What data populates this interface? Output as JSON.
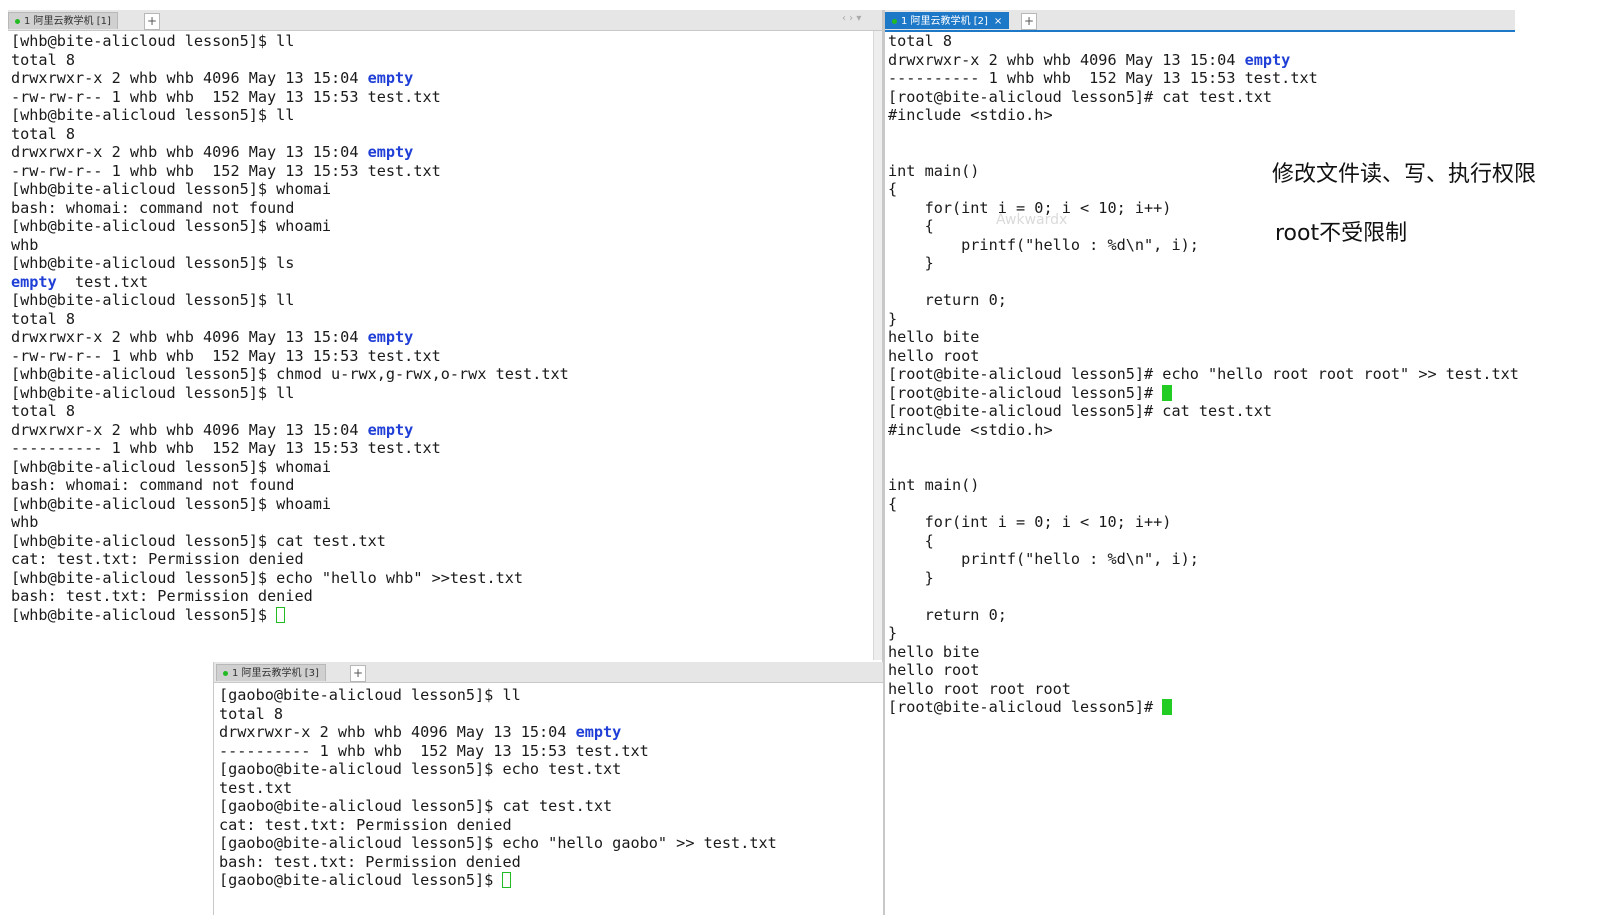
{
  "panes": {
    "left": {
      "tab_label": "1 阿里云教学机 [1]",
      "lines": [
        [
          {
            "t": "[whb@bite-alicloud lesson5]$ ll"
          }
        ],
        [
          {
            "t": "total 8"
          }
        ],
        [
          {
            "t": "drwxrwxr-x 2 whb whb 4096 May 13 15:04 "
          },
          {
            "t": "empty",
            "c": "blue"
          }
        ],
        [
          {
            "t": "-rw-rw-r-- 1 whb whb  152 May 13 15:53 test.txt"
          }
        ],
        [
          {
            "t": "[whb@bite-alicloud lesson5]$ ll"
          }
        ],
        [
          {
            "t": "total 8"
          }
        ],
        [
          {
            "t": "drwxrwxr-x 2 whb whb 4096 May 13 15:04 "
          },
          {
            "t": "empty",
            "c": "blue"
          }
        ],
        [
          {
            "t": "-rw-rw-r-- 1 whb whb  152 May 13 15:53 test.txt"
          }
        ],
        [
          {
            "t": "[whb@bite-alicloud lesson5]$ whomai"
          }
        ],
        [
          {
            "t": "bash: whomai: command not found"
          }
        ],
        [
          {
            "t": "[whb@bite-alicloud lesson5]$ whoami"
          }
        ],
        [
          {
            "t": "whb"
          }
        ],
        [
          {
            "t": "[whb@bite-alicloud lesson5]$ ls"
          }
        ],
        [
          {
            "t": "empty",
            "c": "blue"
          },
          {
            "t": "  test.txt"
          }
        ],
        [
          {
            "t": "[whb@bite-alicloud lesson5]$ ll"
          }
        ],
        [
          {
            "t": "total 8"
          }
        ],
        [
          {
            "t": "drwxrwxr-x 2 whb whb 4096 May 13 15:04 "
          },
          {
            "t": "empty",
            "c": "blue"
          }
        ],
        [
          {
            "t": "-rw-rw-r-- 1 whb whb  152 May 13 15:53 test.txt"
          }
        ],
        [
          {
            "t": "[whb@bite-alicloud lesson5]$ chmod u-rwx,g-rwx,o-rwx test.txt"
          }
        ],
        [
          {
            "t": "[whb@bite-alicloud lesson5]$ ll"
          }
        ],
        [
          {
            "t": "total 8"
          }
        ],
        [
          {
            "t": "drwxrwxr-x 2 whb whb 4096 May 13 15:04 "
          },
          {
            "t": "empty",
            "c": "blue"
          }
        ],
        [
          {
            "t": "---------- 1 whb whb  152 May 13 15:53 test.txt"
          }
        ],
        [
          {
            "t": "[whb@bite-alicloud lesson5]$ whomai"
          }
        ],
        [
          {
            "t": "bash: whomai: command not found"
          }
        ],
        [
          {
            "t": "[whb@bite-alicloud lesson5]$ whoami"
          }
        ],
        [
          {
            "t": "whb"
          }
        ],
        [
          {
            "t": "[whb@bite-alicloud lesson5]$ cat test.txt"
          }
        ],
        [
          {
            "t": "cat: test.txt: Permission denied"
          }
        ],
        [
          {
            "t": "[whb@bite-alicloud lesson5]$ echo \"hello whb\" >>test.txt"
          }
        ],
        [
          {
            "t": "bash: test.txt: Permission denied"
          }
        ],
        [
          {
            "t": "[whb@bite-alicloud lesson5]$ "
          },
          {
            "cursor": "outline"
          }
        ]
      ]
    },
    "right": {
      "tab_label": "1 阿里云教学机 [2]",
      "tab_close": "×",
      "lines": [
        [
          {
            "t": "total 8"
          }
        ],
        [
          {
            "t": "drwxrwxr-x 2 whb whb 4096 May 13 15:04 "
          },
          {
            "t": "empty",
            "c": "blue"
          }
        ],
        [
          {
            "t": "---------- 1 whb whb  152 May 13 15:53 test.txt"
          }
        ],
        [
          {
            "t": "[root@bite-alicloud lesson5]# cat test.txt"
          }
        ],
        [
          {
            "t": "#include <stdio.h>"
          }
        ],
        [
          {
            "t": ""
          }
        ],
        [
          {
            "t": ""
          }
        ],
        [
          {
            "t": "int main()"
          }
        ],
        [
          {
            "t": "{"
          }
        ],
        [
          {
            "t": "    for(int i = 0; i < 10; i++)"
          }
        ],
        [
          {
            "t": "    {"
          }
        ],
        [
          {
            "t": "        printf(\"hello : %d\\n\", i);"
          }
        ],
        [
          {
            "t": "    }"
          }
        ],
        [
          {
            "t": ""
          }
        ],
        [
          {
            "t": "    return 0;"
          }
        ],
        [
          {
            "t": "}"
          }
        ],
        [
          {
            "t": "hello bite"
          }
        ],
        [
          {
            "t": "hello root"
          }
        ],
        [
          {
            "t": "[root@bite-alicloud lesson5]# echo \"hello root root root\" >> test.txt"
          }
        ],
        [
          {
            "t": "[root@bite-alicloud lesson5]# "
          },
          {
            "cursor": "fill"
          }
        ],
        [
          {
            "t": "[root@bite-alicloud lesson5]# cat test.txt"
          }
        ],
        [
          {
            "t": "#include <stdio.h>"
          }
        ],
        [
          {
            "t": ""
          }
        ],
        [
          {
            "t": ""
          }
        ],
        [
          {
            "t": "int main()"
          }
        ],
        [
          {
            "t": "{"
          }
        ],
        [
          {
            "t": "    for(int i = 0; i < 10; i++)"
          }
        ],
        [
          {
            "t": "    {"
          }
        ],
        [
          {
            "t": "        printf(\"hello : %d\\n\", i);"
          }
        ],
        [
          {
            "t": "    }"
          }
        ],
        [
          {
            "t": ""
          }
        ],
        [
          {
            "t": "    return 0;"
          }
        ],
        [
          {
            "t": "}"
          }
        ],
        [
          {
            "t": "hello bite"
          }
        ],
        [
          {
            "t": "hello root"
          }
        ],
        [
          {
            "t": "hello root root root"
          }
        ],
        [
          {
            "t": "[root@bite-alicloud lesson5]# "
          },
          {
            "cursor": "fill"
          }
        ]
      ]
    },
    "bottom": {
      "tab_label": "1 阿里云教学机 [3]",
      "lines": [
        [
          {
            "t": "[gaobo@bite-alicloud lesson5]$ ll"
          }
        ],
        [
          {
            "t": "total 8"
          }
        ],
        [
          {
            "t": "drwxrwxr-x 2 whb whb 4096 May 13 15:04 "
          },
          {
            "t": "empty",
            "c": "blue"
          }
        ],
        [
          {
            "t": "---------- 1 whb whb  152 May 13 15:53 test.txt"
          }
        ],
        [
          {
            "t": "[gaobo@bite-alicloud lesson5]$ echo test.txt"
          }
        ],
        [
          {
            "t": "test.txt"
          }
        ],
        [
          {
            "t": "[gaobo@bite-alicloud lesson5]$ cat test.txt"
          }
        ],
        [
          {
            "t": "cat: test.txt: Permission denied"
          }
        ],
        [
          {
            "t": "[gaobo@bite-alicloud lesson5]$ echo \"hello gaobo\" >> test.txt"
          }
        ],
        [
          {
            "t": "bash: test.txt: Permission denied"
          }
        ],
        [
          {
            "t": "[gaobo@bite-alicloud lesson5]$ "
          },
          {
            "cursor": "outline"
          }
        ]
      ]
    }
  },
  "annotations": {
    "note_1": "修改文件读、写、执行权限",
    "note_2": "root不受限制"
  },
  "watermark": "Awkwardx",
  "tab_add_label": "+",
  "colors": {
    "tab_active": "#1e78c8",
    "dir_blue": "#1f3fd6",
    "cursor_green": "#22cc22"
  }
}
